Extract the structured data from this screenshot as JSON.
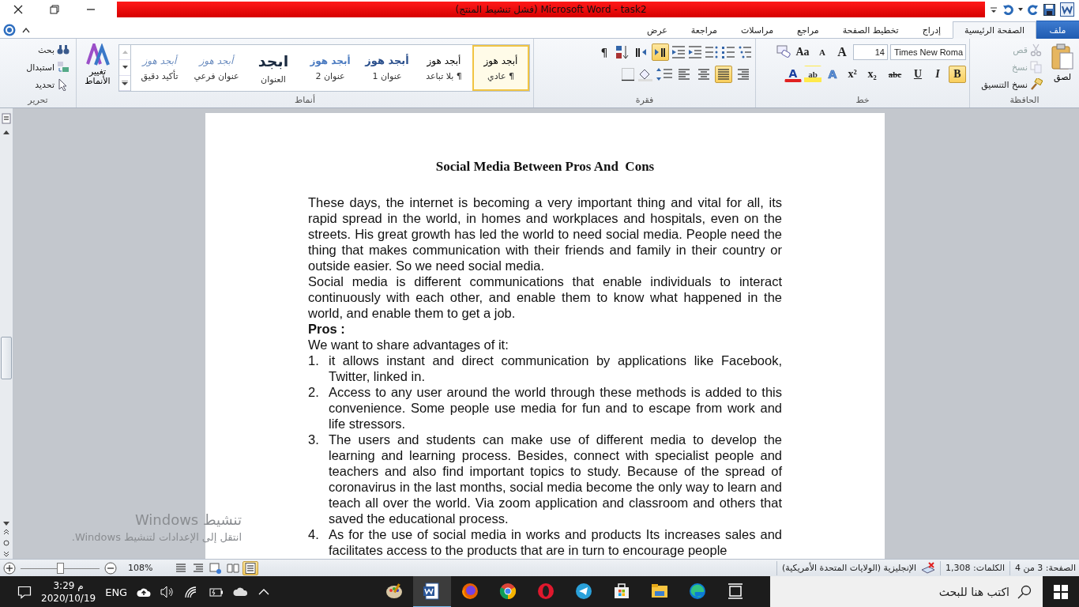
{
  "title_bar": {
    "title": "(فشل تنشيط المنتج) Microsoft Word  -  task2"
  },
  "tabs": [
    {
      "label": "ملف",
      "kind": "file",
      "selected": false
    },
    {
      "label": "الصفحة الرئيسية",
      "kind": "tab",
      "selected": true
    },
    {
      "label": "إدراج",
      "kind": "tab",
      "selected": false
    },
    {
      "label": "تخطيط الصفحة",
      "kind": "tab",
      "selected": false
    },
    {
      "label": "مراجع",
      "kind": "tab",
      "selected": false
    },
    {
      "label": "مراسلات",
      "kind": "tab",
      "selected": false
    },
    {
      "label": "مراجعة",
      "kind": "tab",
      "selected": false
    },
    {
      "label": "عرض",
      "kind": "tab",
      "selected": false
    }
  ],
  "clipboard": {
    "label": "الحافظة",
    "paste": "لصق",
    "items": [
      {
        "label": "قص",
        "kind": "cut",
        "disabled": true
      },
      {
        "label": "نسخ",
        "kind": "copy",
        "disabled": true
      },
      {
        "label": "نسخ التنسيق",
        "kind": "painter",
        "disabled": false
      }
    ]
  },
  "font": {
    "label": "خط",
    "name": "Times New Roma",
    "size": "14",
    "tools": [
      {
        "glyph": "A",
        "kind": "grow"
      },
      {
        "glyph": "A",
        "kind": "shrink"
      },
      {
        "glyph": "Aa",
        "kind": "case"
      }
    ],
    "buttons": [
      {
        "glyph": "B",
        "kind": "bold",
        "selected": true
      },
      {
        "glyph": "I",
        "kind": "italic",
        "selected": false
      },
      {
        "glyph": "U",
        "kind": "underline",
        "selected": false
      },
      {
        "glyph": "abc",
        "kind": "strike",
        "selected": false
      },
      {
        "glyph": "x₂",
        "kind": "sub",
        "selected": false
      },
      {
        "glyph": "x²",
        "kind": "sup",
        "selected": false
      }
    ],
    "effects_glyph": "A",
    "color_glyph": "A",
    "highlight_glyph": "ab"
  },
  "paragraph": {
    "label": "فقرة",
    "show_marks": "¶",
    "direction": [
      {
        "kind": "ltr",
        "selected": true
      },
      {
        "kind": "rtl",
        "selected": false
      }
    ],
    "alignment": [
      {
        "kind": "right",
        "selected": false
      },
      {
        "kind": "justify",
        "selected": true
      },
      {
        "kind": "center",
        "selected": false
      },
      {
        "kind": "left",
        "selected": false
      }
    ]
  },
  "styles": {
    "label": "أنماط",
    "change": "تغيير الأنماط",
    "items": [
      {
        "preview": "أبجد هوز",
        "label": "¶ عادي",
        "kind": "normal",
        "selected": true
      },
      {
        "preview": "أبجد هوز",
        "label": "¶ بلا تباعد",
        "kind": "normal",
        "selected": false
      },
      {
        "preview": "أبجد هوز",
        "label": "عنوان 1",
        "kind": "heading1",
        "selected": false
      },
      {
        "preview": "أبجد هوز",
        "label": "عنوان 2",
        "kind": "heading2",
        "selected": false
      },
      {
        "preview": "ابجد",
        "label": "العنوان",
        "kind": "title",
        "selected": false
      },
      {
        "preview": "أبجد هوز",
        "label": "عنوان فرعي",
        "kind": "subtitle",
        "selected": false
      },
      {
        "preview": "أبجد هوز",
        "label": "تأكيد دقيق",
        "kind": "subtle",
        "selected": false
      }
    ]
  },
  "editing": {
    "label": "تحرير",
    "items": [
      {
        "label": "بحث",
        "kind": "find"
      },
      {
        "label": "استبدال",
        "kind": "replace"
      },
      {
        "label": "تحديد",
        "kind": "select"
      }
    ]
  },
  "document": {
    "title": "Social Media Between Pros And  Cons",
    "blocks": [
      {
        "kind": "paragraph",
        "text": "These days, the internet is becoming a very important thing and vital for all, its rapid spread in the world, in homes and workplaces and hospitals, even on the streets. His great growth has led the world to need social media. People need the thing that makes communication with their friends and family in their country or outside easier. So we need social media."
      },
      {
        "kind": "paragraph",
        "text": "Social media is different communications that enable individuals to interact continuously with each other, and enable them to know what happened in the world, and enable them to get a job."
      },
      {
        "kind": "heading",
        "text": "Pros :"
      },
      {
        "kind": "paragraph",
        "text": "We want to share advantages of it:"
      },
      {
        "kind": "list_item",
        "number": "1.",
        "text": "it allows instant and direct communication by applications like Facebook, Twitter, linked in."
      },
      {
        "kind": "list_item",
        "number": "2.",
        "text": "Access to any user around the world through these methods is added to this convenience. Some people use media for fun and to escape from work and life stressors."
      },
      {
        "kind": "list_item",
        "number": "3.",
        "text": "The users and students can make use of different media to develop the learning and learning process. Besides, connect with specialist people and teachers and also find important topics to study. Because of the spread of coronavirus in the last months, social media become the only way to learn and teach all over the world. Via zoom application and classroom and others that saved the educational process."
      },
      {
        "kind": "list_item",
        "number": "4.",
        "text": "As for the use of social media in works and products Its increases sales and facilitates access to the products that are in turn to encourage people"
      }
    ]
  },
  "activation": {
    "title": "تنشيط Windows",
    "text": "انتقل إلى الإعدادات لتنشيط Windows."
  },
  "status_bar": {
    "page": "الصفحة: 3 من 4",
    "words": "الكلمات: 1,308",
    "language": "الإنجليزية (الولايات المتحدة الأمريكية)",
    "zoom": "108%",
    "zoom_level": {
      "level": 0.5
    },
    "views": [
      {
        "kind": "draft",
        "selected": false
      },
      {
        "kind": "outline",
        "selected": false
      },
      {
        "kind": "web",
        "selected": false
      },
      {
        "kind": "reading",
        "selected": false
      },
      {
        "kind": "print",
        "selected": true
      }
    ]
  },
  "taskbar": {
    "time": "3:29 م",
    "date": "2020/10/19",
    "language": "ENG",
    "search": {
      "placeholder": "اكتب هنا للبحث"
    },
    "apps": [
      {
        "kind": "paint",
        "selected": false
      },
      {
        "kind": "word",
        "selected": true
      },
      {
        "kind": "firefox",
        "selected": false
      },
      {
        "kind": "chrome",
        "selected": false
      },
      {
        "kind": "opera",
        "selected": false
      },
      {
        "kind": "telegram",
        "selected": false
      },
      {
        "kind": "store",
        "selected": false
      },
      {
        "kind": "explorer",
        "selected": false
      },
      {
        "kind": "edge",
        "selected": false
      },
      {
        "kind": "taskview",
        "selected": false
      }
    ]
  }
}
